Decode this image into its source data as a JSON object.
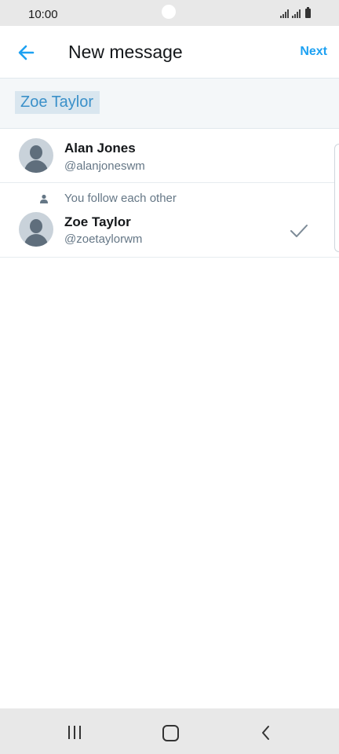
{
  "status_bar": {
    "time": "10:00"
  },
  "header": {
    "title": "New message",
    "next_label": "Next"
  },
  "search": {
    "chip_text": "Zoe Taylor"
  },
  "results": [
    {
      "name": "Alan Jones",
      "handle": "@alanjoneswm",
      "context": "",
      "selected": false
    },
    {
      "name": "Zoe Taylor",
      "handle": "@zoetaylorwm",
      "context": "You follow each other",
      "selected": true
    }
  ],
  "colors": {
    "accent": "#1da1f2",
    "text": "#14171a",
    "secondary": "#657786"
  },
  "icons": {
    "back": "arrow-left-icon",
    "follow": "person-icon",
    "selected": "checkmark-icon"
  }
}
